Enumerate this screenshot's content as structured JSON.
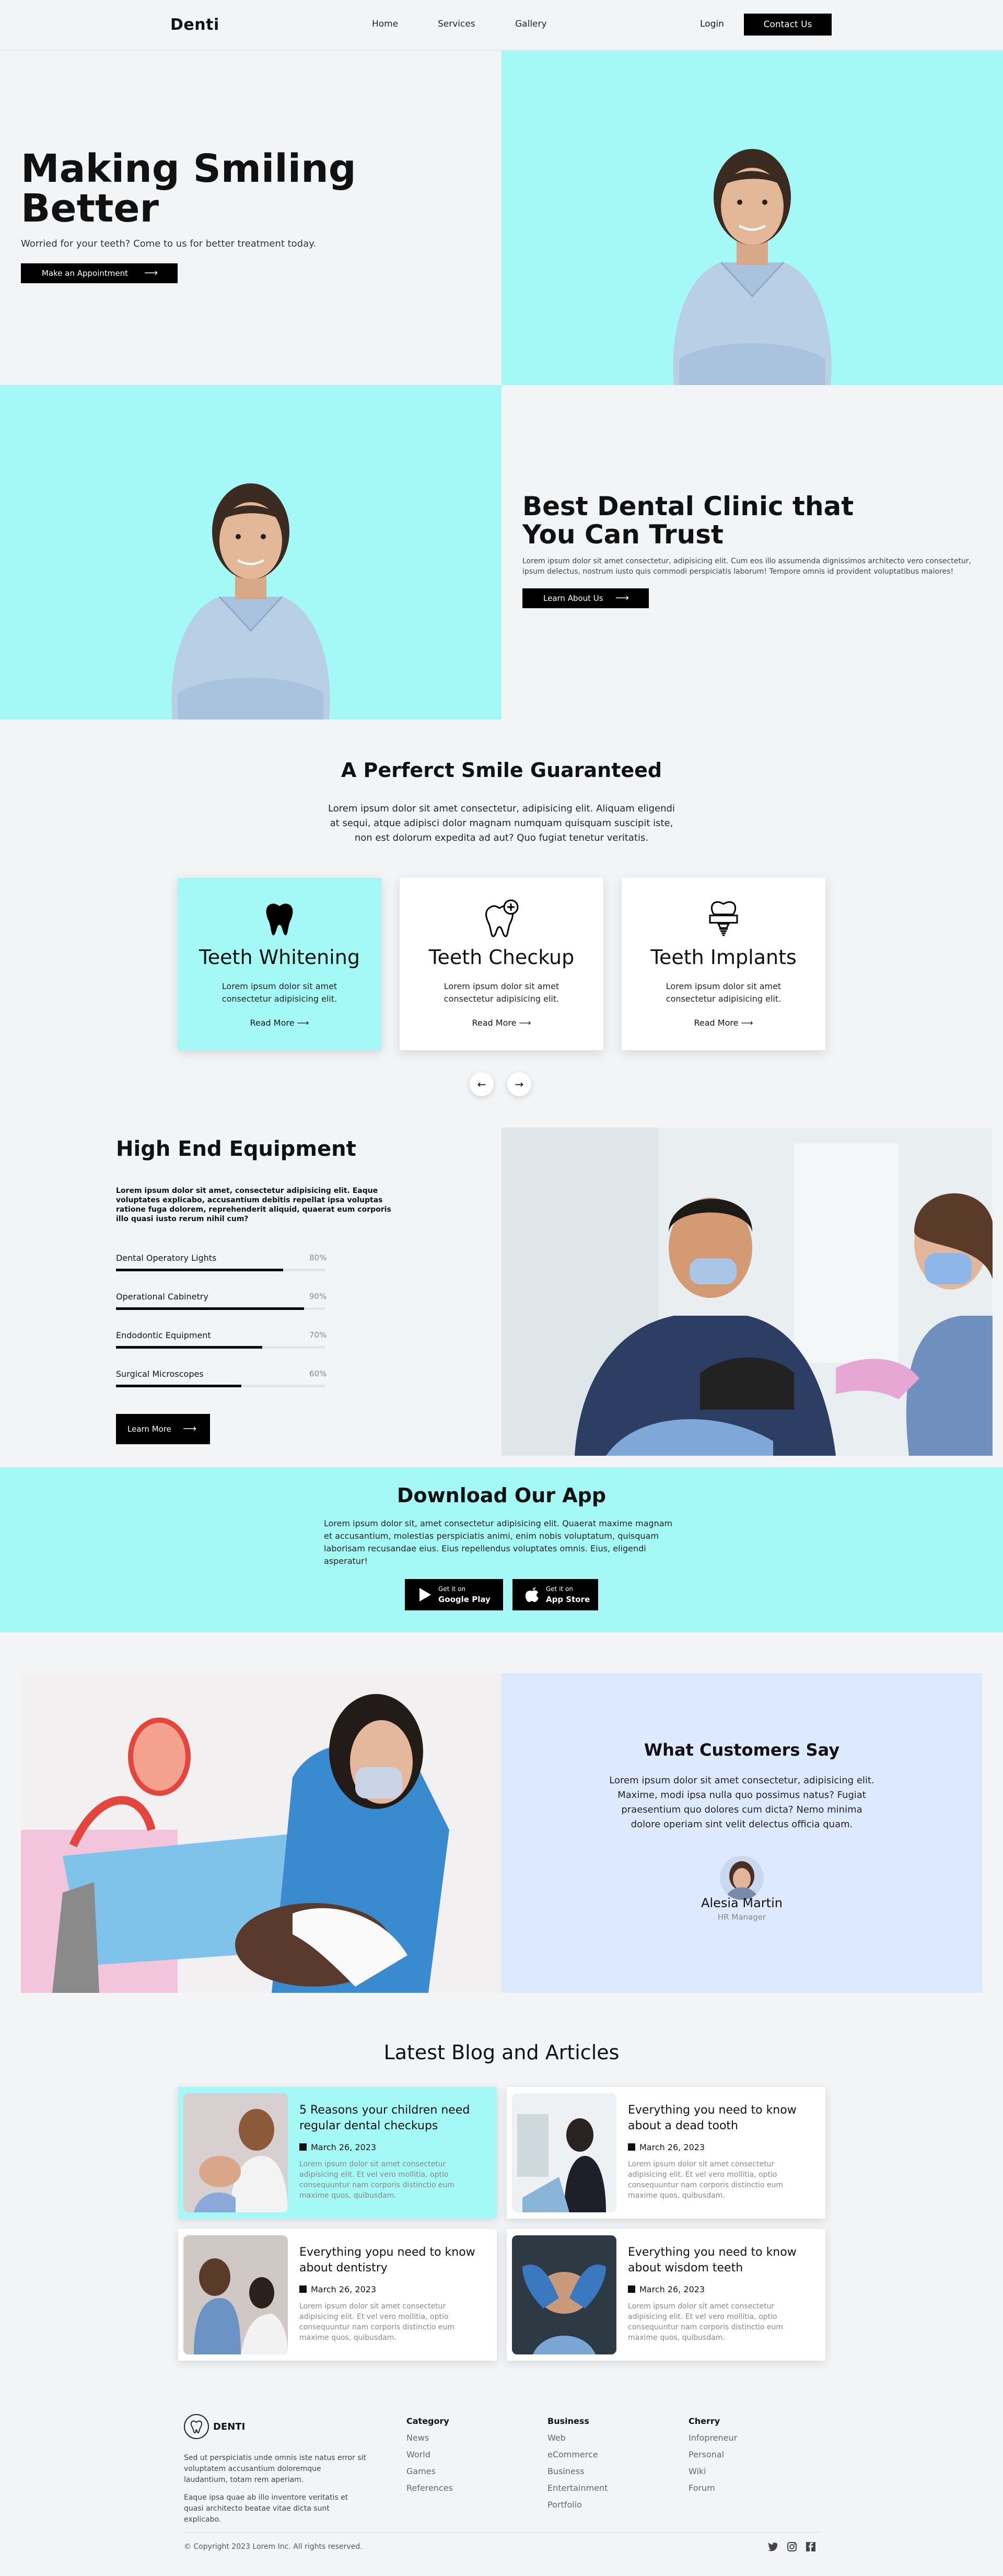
{
  "header": {
    "logo": "Denti",
    "nav": [
      "Home",
      "Services",
      "Gallery"
    ],
    "login": "Login",
    "contact": "Contact Us"
  },
  "hero": {
    "title": "Making Smiling Better",
    "subtitle": "Worried for your teeth? Come to us for better treatment today.",
    "button": "Make an Appointment"
  },
  "trust": {
    "title": "Best Dental Clinic that You Can Trust",
    "text": "Lorem ipsum dolor sit amet consectetur, adipisicing elit. Cum eos illo assumenda dignissimos architecto vero consectetur, ipsum delectus, nostrum iusto quis commodi perspiciatis laborum! Tempore omnis id provident voluptatibus maiores!",
    "button": "Learn About Us"
  },
  "smile": {
    "title": "A Perferct Smile Guaranteed",
    "text": "Lorem ipsum dolor sit amet consectetur, adipisicing elit. Aliquam eligendi at sequi, atque adipisci dolor magnam numquam quisquam suscipit iste, non est dolorum expedita ad aut? Quo fugiat tenetur veritatis.",
    "cards": [
      {
        "title": "Teeth Whitening",
        "text": "Lorem ipsum dolor sit amet consectetur adipisicing elit.",
        "more": "Read More",
        "icon": "tooth-icon"
      },
      {
        "title": "Teeth Checkup",
        "text": "Lorem ipsum dolor sit amet consectetur adipisicing elit.",
        "more": "Read More",
        "icon": "tooth-plus-icon"
      },
      {
        "title": "Teeth Implants",
        "text": "Lorem ipsum dolor sit amet consectetur adipisicing elit.",
        "more": "Read More",
        "icon": "implant-icon"
      }
    ],
    "prev": "←",
    "next": "→"
  },
  "equipment": {
    "title": "High End Equipment",
    "text": "Lorem ipsum dolor sit amet, consectetur adipisicing elit. Eaque voluptates explicabo, accusantium debitis repellat ipsa voluptas ratione fuga dolorem, reprehenderit aliquid, quaerat eum corporis illo quasi iusto rerum nihil cum?",
    "bars": [
      {
        "label": "Dental Operatory Lights",
        "value": 80,
        "pct": "80%"
      },
      {
        "label": "Operational Cabinetry",
        "value": 90,
        "pct": "90%"
      },
      {
        "label": "Endodontic Equipment",
        "value": 70,
        "pct": "70%"
      },
      {
        "label": "Surgical Microscopes",
        "value": 60,
        "pct": "60%"
      }
    ],
    "button": "Learn More"
  },
  "app": {
    "title": "Download Our App",
    "text": "Lorem ipsum dolor sit, amet consectetur adipisicing elit. Quaerat maxime magnam et accusantium, molestias perspiciatis animi, enim nobis voluptatum, quisquam laborisam recusandae eius. Eius repellendus voluptates omnis. Eius, eligendi asperatur!",
    "google_small": "Get it on",
    "google_big": "Google Play",
    "apple_small": "Get it on",
    "apple_big": "App Store"
  },
  "testimonial": {
    "title": "What Customers Say",
    "text": "Lorem ipsum dolor sit amet consectetur, adipisicing elit. Maxime, modi ipsa nulla quo possimus natus? Fugiat praesentium quo dolores cum dicta? Nemo minima dolore operiam sint velit delectus officia quam.",
    "name": "Alesia Martin",
    "role": "HR Manager"
  },
  "blog": {
    "title": "Latest Blog and Articles",
    "posts": [
      {
        "title": "5 Reasons your children need regular dental checkups",
        "date": "March 26, 2023",
        "text": "Lorem ipsum dolor sit amet consectetur adipisicing elit. Et vel vero mollitia, optio consequuntur nam corporis distinctio eum maxime quos, quibusdam."
      },
      {
        "title": "Everything you need to know about a dead tooth",
        "date": "March 26, 2023",
        "text": "Lorem ipsum dolor sit amet consectetur adipisicing elit. Et vel vero mollitia, optio consequuntur nam corporis distinctio eum maxime quos, quibusdam."
      },
      {
        "title": "Everything yopu need to know about dentistry",
        "date": "March 26, 2023",
        "text": "Lorem ipsum dolor sit amet consectetur adipisicing elit. Et vel vero mollitia, optio consequuntur nam corporis distinctio eum maxime quos, quibusdam."
      },
      {
        "title": "Everything you need to know about wisdom teeth",
        "date": "March 26, 2023",
        "text": "Lorem ipsum dolor sit amet consectetur adipisicing elit. Et vel vero mollitia, optio consequuntur nam corporis distinctio eum maxime quos, quibusdam."
      }
    ]
  },
  "footer": {
    "logo": "DENTI",
    "text1": "Sed ut perspiciatis unde omnis iste natus error sit voluptatem accusantium doloremque laudantium, totam rem aperiam.",
    "text2": "Eaque ipsa quae ab illo inventore veritatis et quasi architecto beatae vitae dicta sunt explicabo.",
    "columns": [
      {
        "head": "Category",
        "links": [
          "News",
          "World",
          "Games",
          "References"
        ]
      },
      {
        "head": "Business",
        "links": [
          "Web",
          "eCommerce",
          "Business",
          "Entertainment",
          "Portfolio"
        ]
      },
      {
        "head": "Cherry",
        "links": [
          "Infopreneur",
          "Personal",
          "Wiki",
          "Forum"
        ]
      }
    ],
    "copyright": "© Copyright 2023 Lorem Inc. All rights reserved."
  },
  "colors": {
    "accent": "#a4f9f6",
    "panel": "#dde9ff",
    "dark": "#000000"
  }
}
